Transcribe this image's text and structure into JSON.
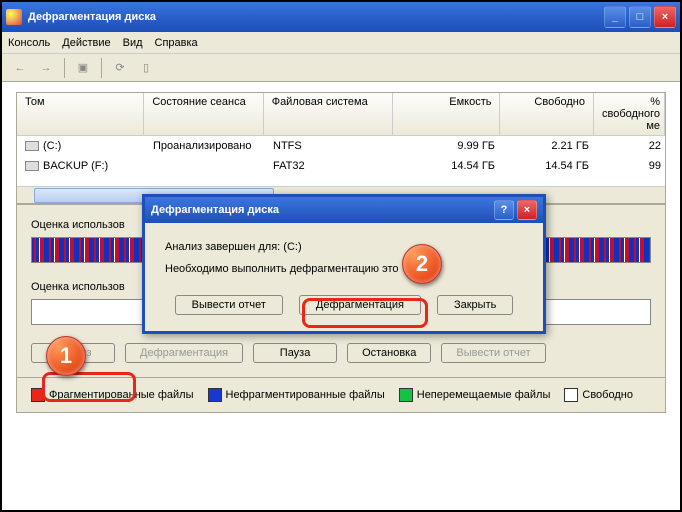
{
  "window": {
    "title": "Дефрагментация диска"
  },
  "menu": {
    "console": "Консоль",
    "action": "Действие",
    "view": "Вид",
    "help": "Справка"
  },
  "table": {
    "headers": {
      "vol": "Том",
      "state": "Состояние сеанса",
      "fs": "Файловая система",
      "cap": "Емкость",
      "free": "Свободно",
      "pct": "% свободного ме"
    },
    "rows": [
      {
        "vol": "(C:)",
        "state": "Проанализировано",
        "fs": "NTFS",
        "cap": "9.99 ГБ",
        "free": "2.21 ГБ",
        "pct": "22"
      },
      {
        "vol": "BACKUP (F:)",
        "state": "",
        "fs": "FAT32",
        "cap": "14.54 ГБ",
        "free": "14.54 ГБ",
        "pct": "99"
      }
    ]
  },
  "labels": {
    "before": "Оценка использов",
    "after": "Оценка использов"
  },
  "buttons": {
    "analyze": "Анализ",
    "defrag": "Дефрагментация",
    "pause": "Пауза",
    "stop": "Остановка",
    "report": "Вывести отчет"
  },
  "legend": {
    "frag": "Фрагментированные файлы",
    "nofrag": "Нефрагментированные файлы",
    "immov": "Неперемещаемые файлы",
    "free": "Свободно"
  },
  "dialog": {
    "title": "Дефрагментация диска",
    "line1": "Анализ завершен для: (C:)",
    "line2": "Необходимо выполнить дефрагментацию это",
    "report": "Вывести отчет",
    "defrag": "Дефрагментация",
    "close": "Закрыть"
  },
  "markers": {
    "m1": "1",
    "m2": "2"
  },
  "colors": {
    "frag": "#e8261a",
    "nofrag": "#1838d0",
    "immov": "#18c048",
    "free": "#ffffff"
  }
}
